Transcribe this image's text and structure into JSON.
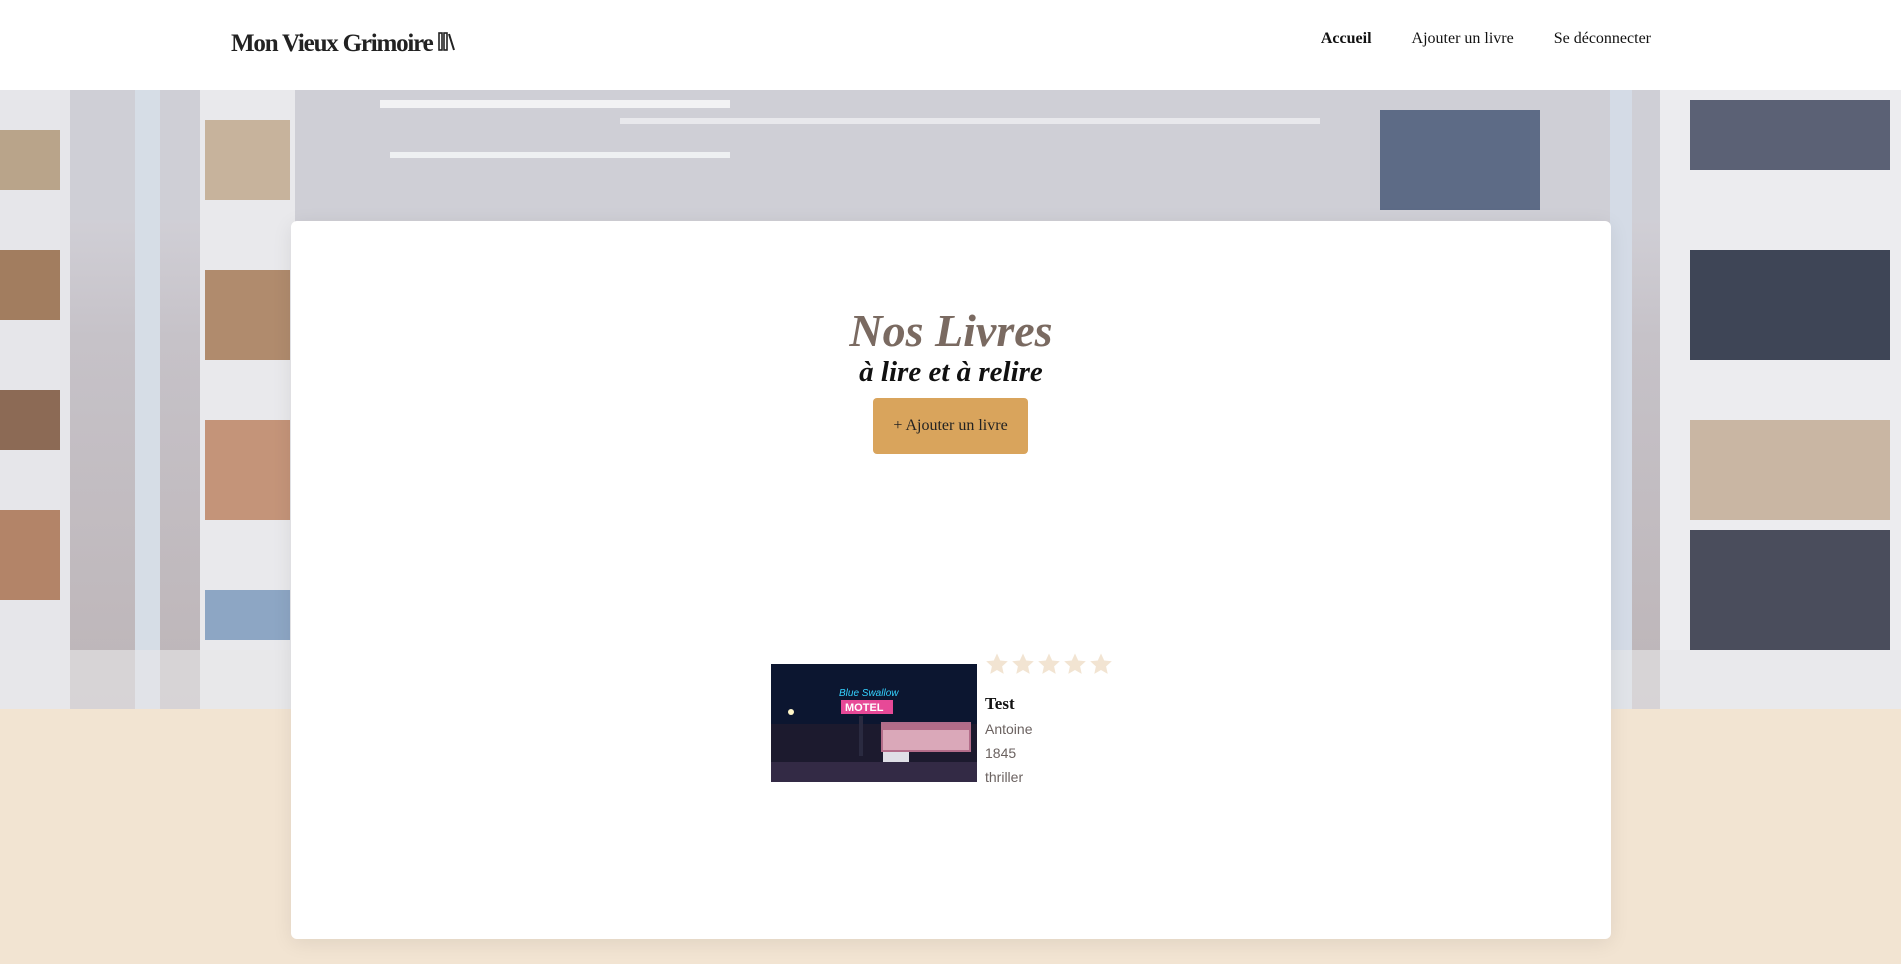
{
  "header": {
    "logo_text": "Mon Vieux Grimoire",
    "logo_icon": "books-icon",
    "nav": [
      {
        "label": "Accueil",
        "active": true
      },
      {
        "label": "Ajouter un livre",
        "active": false
      },
      {
        "label": "Se déconnecter",
        "active": false
      }
    ]
  },
  "main": {
    "title": "Nos Livres",
    "subtitle": "à lire et à relire",
    "add_button_label": "+ Ajouter un livre"
  },
  "books": [
    {
      "title": "Test",
      "author": "Antoine",
      "year": "1845",
      "genre": "thriller",
      "rating": 0,
      "rating_max": 5,
      "cover": "motel-neon-image"
    }
  ],
  "colors": {
    "accent": "#d9a45c",
    "title": "#7a6a61",
    "page_bg": "#f2e4d2",
    "star_empty": "#f2e4d2"
  }
}
